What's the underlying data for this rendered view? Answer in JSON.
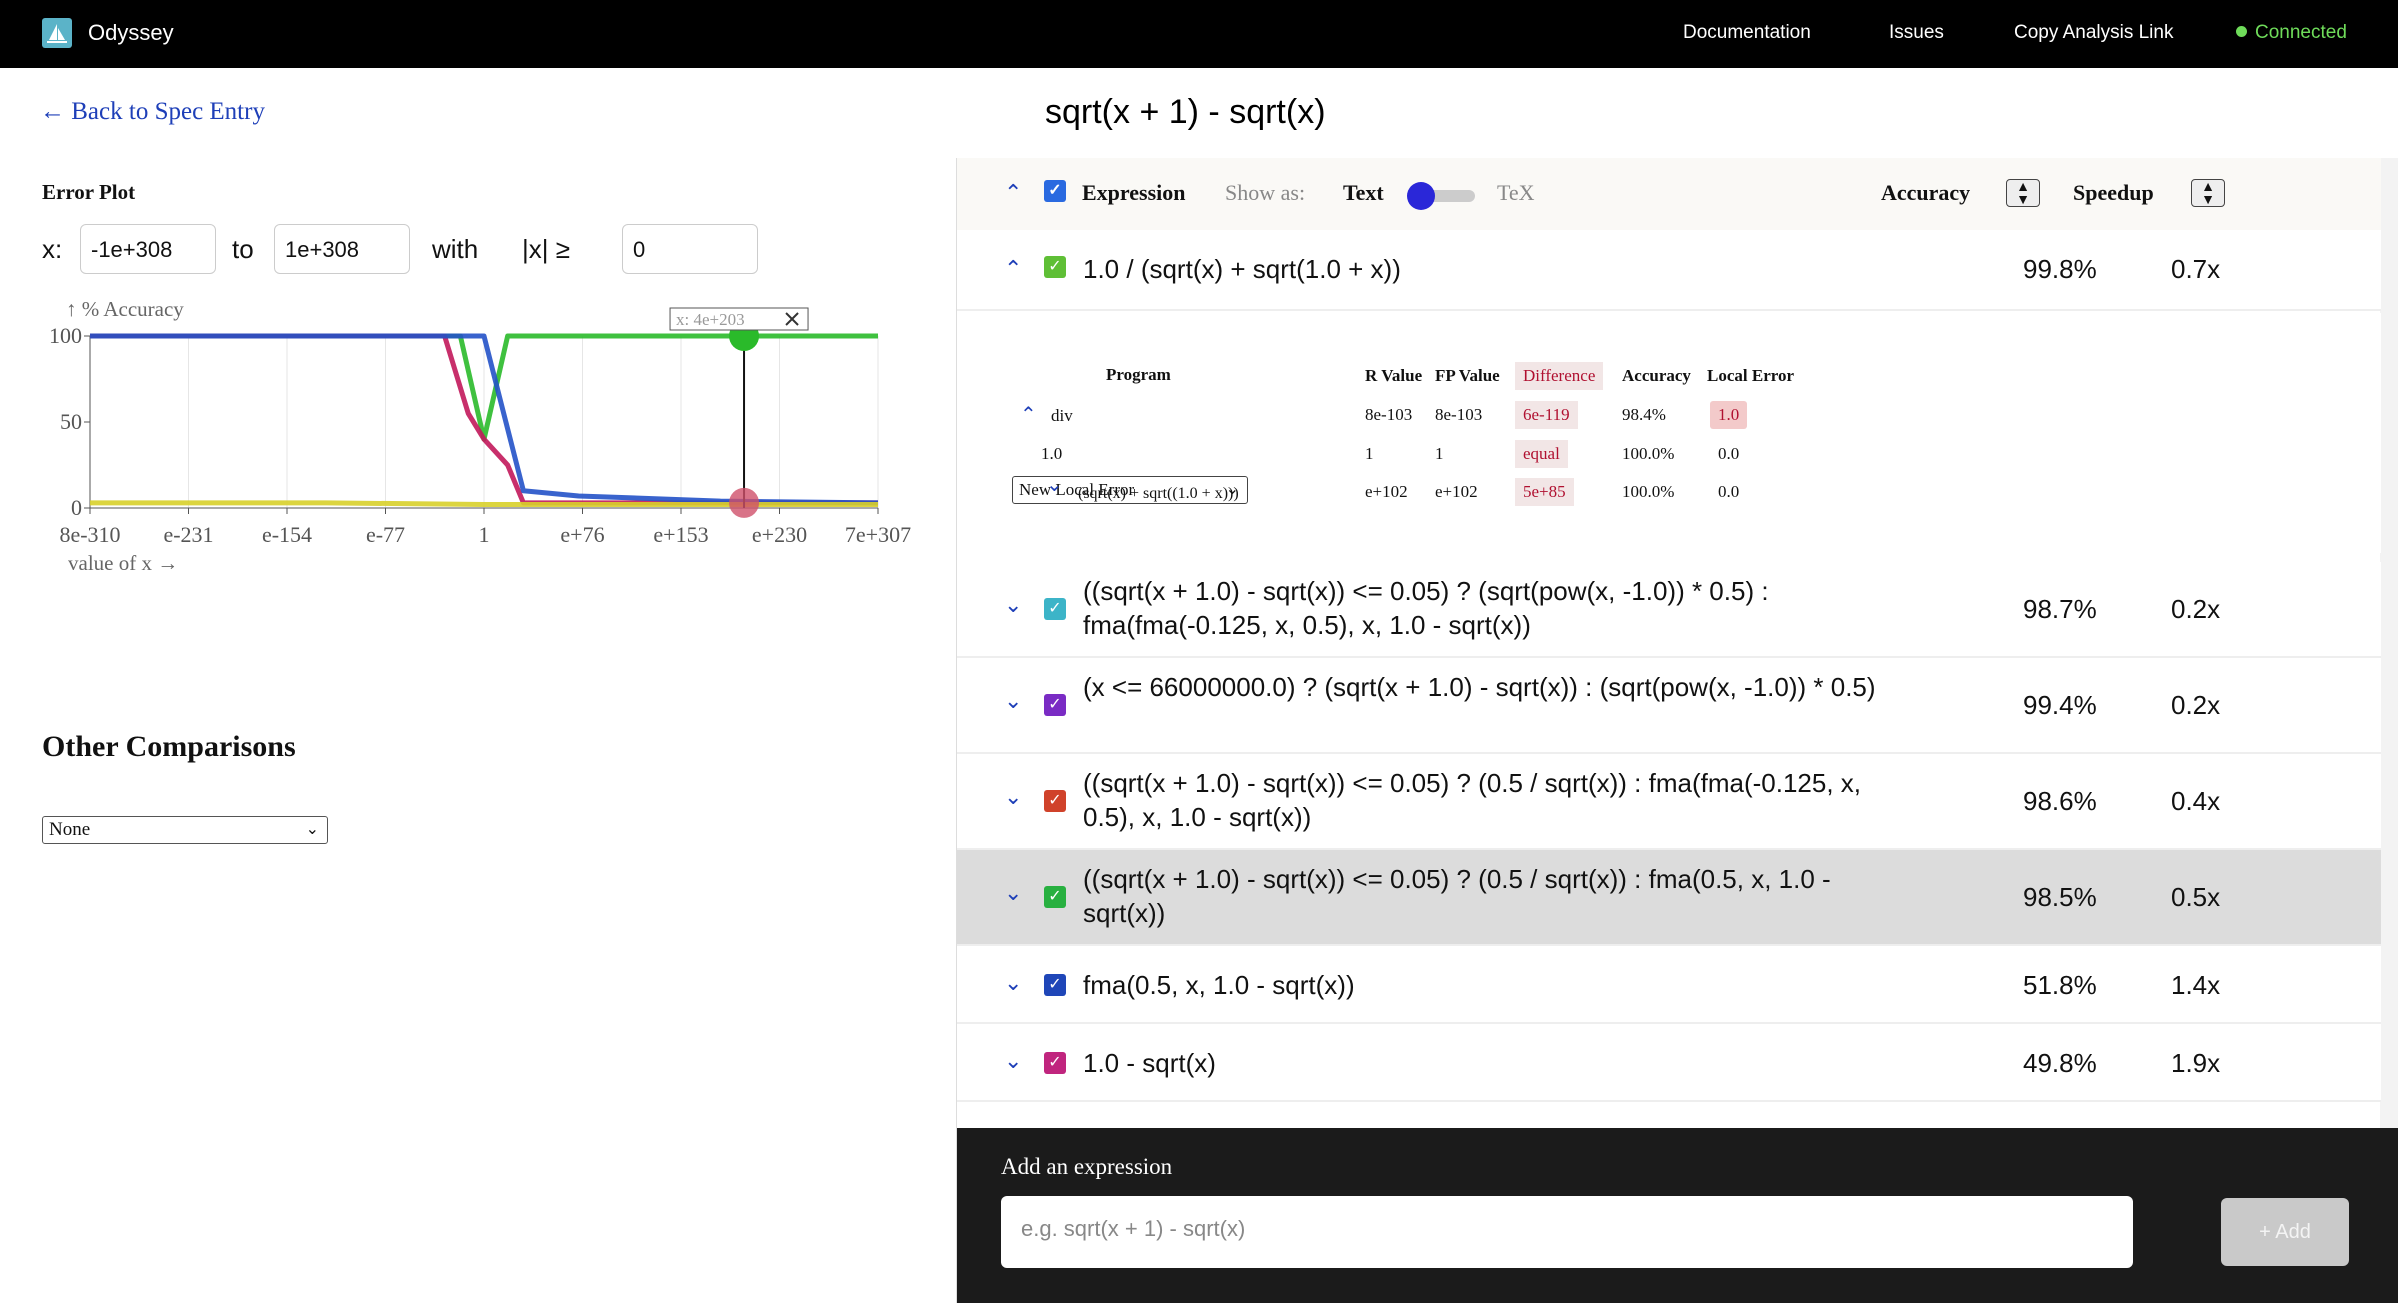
{
  "topbar": {
    "app_name": "Odyssey",
    "nav": [
      "Documentation",
      "Issues",
      "Copy Analysis Link"
    ],
    "status": "Connected",
    "status_color": "#6fdc5a"
  },
  "header": {
    "back_label": "← Back to Spec Entry",
    "title": "sqrt(x + 1) - sqrt(x)"
  },
  "left": {
    "plot_title": "Error Plot",
    "x_label": "x:",
    "x_from": "-1e+308",
    "to_label": "to",
    "x_to": "1e+308",
    "with_label": "with",
    "abs_label": "|x| ≥",
    "abs_value": "0",
    "other_title": "Other Comparisons",
    "other_select": "None"
  },
  "chart_data": {
    "type": "line",
    "ylabel": "↑ % Accuracy",
    "xlabel": "value of x →",
    "ylim": [
      0,
      100
    ],
    "yticks": [
      "100",
      "50",
      "0"
    ],
    "xticks": [
      "8e-310",
      "e-231",
      "e-154",
      "e-77",
      "1",
      "e+76",
      "e+153",
      "e+230",
      "7e+307"
    ],
    "tooltip": "x: 4e+203",
    "grid": true,
    "series": [
      {
        "color": "#2aba2a",
        "x": [
          0,
          0.44,
          0.47,
          0.5,
          0.53,
          0.56,
          1
        ],
        "values": [
          100,
          100,
          100,
          40,
          100,
          100,
          100
        ]
      },
      {
        "color": "#c2185b",
        "x": [
          0,
          0.45,
          0.48,
          0.5,
          0.53,
          0.55,
          1
        ],
        "values": [
          100,
          100,
          55,
          40,
          25,
          3,
          3
        ]
      },
      {
        "color": "#2452c8",
        "x": [
          0,
          0.5,
          0.55,
          0.62,
          0.8,
          1
        ],
        "values": [
          100,
          100,
          10,
          7,
          4,
          3
        ]
      },
      {
        "color": "#d8d02a",
        "x": [
          0,
          0.3,
          0.5,
          0.7,
          1
        ],
        "values": [
          3,
          3,
          2,
          2,
          2
        ]
      }
    ]
  },
  "expressions": {
    "header": {
      "expression_label": "Expression",
      "show_as": "Show as:",
      "text_label": "Text",
      "tex_label": "TeX",
      "accuracy_label": "Accuracy",
      "speedup_label": "Speedup"
    },
    "rows": [
      {
        "text": "1.0 / (sqrt(x) + sqrt(1.0 + x))",
        "accuracy": "99.8%",
        "speedup": "0.7x",
        "color": "#5fbf36"
      },
      {
        "text": "((sqrt(x + 1.0) - sqrt(x)) <= 0.05) ? (sqrt(pow(x, -1.0)) * 0.5) : fma(fma(-0.125, x, 0.5), x, 1.0 - sqrt(x))",
        "accuracy": "98.7%",
        "speedup": "0.2x",
        "color": "#3cb4c8"
      },
      {
        "text": "(x <= 66000000.0) ? (sqrt(x + 1.0) - sqrt(x)) : (sqrt(pow(x, -1.0)) * 0.5)",
        "accuracy": "99.4%",
        "speedup": "0.2x",
        "color": "#7a2bc4"
      },
      {
        "text": "((sqrt(x + 1.0) - sqrt(x)) <= 0.05) ? (0.5 / sqrt(x)) : fma(fma(-0.125, x, 0.5), x, 1.0 - sqrt(x))",
        "accuracy": "98.6%",
        "speedup": "0.4x",
        "color": "#d0422a"
      },
      {
        "text": "((sqrt(x + 1.0) - sqrt(x)) <= 0.05) ? (0.5 / sqrt(x)) : fma(0.5, x, 1.0 - sqrt(x))",
        "accuracy": "98.5%",
        "speedup": "0.5x",
        "color": "#28b040"
      },
      {
        "text": "fma(0.5, x, 1.0 - sqrt(x))",
        "accuracy": "51.8%",
        "speedup": "1.4x",
        "color": "#1f46b8"
      },
      {
        "text": "1.0 - sqrt(x)",
        "accuracy": "49.8%",
        "speedup": "1.9x",
        "color": "#c0257e"
      }
    ]
  },
  "local_error": {
    "select": "New Local Error",
    "headers": [
      "Program",
      "R Value",
      "FP Value",
      "Difference",
      "Accuracy",
      "Local Error"
    ],
    "rows": [
      {
        "program": "div",
        "r": "8e-103",
        "fp": "8e-103",
        "diff": "6e-119",
        "acc": "98.4%",
        "local": "1.0"
      },
      {
        "program": "1.0",
        "r": "1",
        "fp": "1",
        "diff": "equal",
        "acc": "100.0%",
        "local": "0.0"
      },
      {
        "program": "(sqrt(x) + sqrt((1.0 + x)))",
        "r": "e+102",
        "fp": "e+102",
        "diff": "5e+85",
        "acc": "100.0%",
        "local": "0.0"
      }
    ]
  },
  "add": {
    "label": "Add an expression",
    "placeholder": "e.g. sqrt(x + 1) - sqrt(x)",
    "button": "+ Add"
  }
}
